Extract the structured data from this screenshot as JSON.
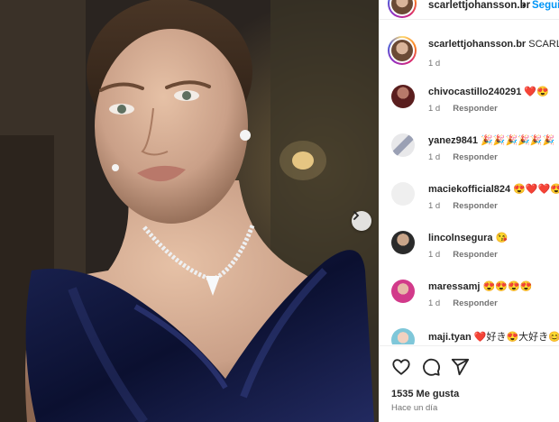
{
  "header": {
    "username": "scarlettjohansson.br",
    "separator": "•",
    "follow_label": "Seguir"
  },
  "post": {
    "username": "scarlettjohansson.br",
    "caption": "SCARLETT",
    "time": "1 d"
  },
  "reply_label": "Responder",
  "comments": [
    {
      "username": "chivocastillo240291",
      "text": "❤️😍",
      "time": "1 d"
    },
    {
      "username": "yanez9841",
      "text": "🎉🎉🎉🎉🎉🎉",
      "time": "1 d"
    },
    {
      "username": "maciekofficial824",
      "text": "😍❤️❤️😍",
      "time": "1 d"
    },
    {
      "username": "lincolnsegura",
      "text": "😘",
      "time": "1 d"
    },
    {
      "username": "maressamj",
      "text": "😍😍😍😍",
      "time": "1 d"
    },
    {
      "username": "maji.tyan",
      "text": "❤️好き😍大好き😊",
      "time": ""
    }
  ],
  "likes": "1535 Me gusta",
  "posted_ago": "Hace un día",
  "icons": [
    "heart-icon",
    "comment-icon",
    "share-icon",
    "chevron-right-icon"
  ],
  "colors": {
    "accent": "#0095f6",
    "dress": "#0b1030",
    "background": "#2a2420"
  }
}
